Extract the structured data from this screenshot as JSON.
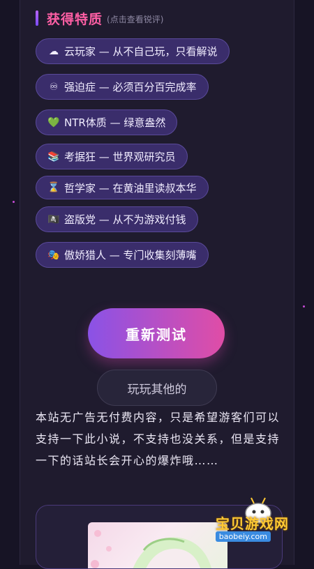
{
  "section": {
    "title": "获得特质",
    "hint": "(点击查看锐评)"
  },
  "traits": [
    {
      "icon": "cloud-icon",
      "glyph": "☁",
      "label": "云玩家 — 从不自己玩，只看解说"
    },
    {
      "icon": "infinity-icon",
      "glyph": "♾",
      "label": "强迫症 — 必须百分百完成率"
    },
    {
      "icon": "green-heart-icon",
      "glyph": "💚",
      "label": "NTR体质 — 绿意盎然"
    },
    {
      "icon": "books-icon",
      "glyph": "📚",
      "label": "考据狂 — 世界观研究员"
    },
    {
      "icon": "hourglass-icon",
      "glyph": "⌛",
      "label": "哲学家 — 在黄油里读叔本华"
    },
    {
      "icon": "pirate-flag-icon",
      "glyph": "🏴‍☠️",
      "label": "盗版党 — 从不为游戏付钱"
    },
    {
      "icon": "theater-masks-icon",
      "glyph": "🎭",
      "label": "傲娇猎人 — 专门收集刻薄嘴"
    }
  ],
  "buttons": {
    "retry": "重新测试",
    "other": "玩玩其他的"
  },
  "notice": "本站无广告无付费内容，只是希望游客们可以支持一下此小说，不支持也没关系，但是支持一下的话站长会开心的爆炸哦……",
  "watermark": {
    "title": "宝贝游戏网",
    "url": "baobeiy.com"
  }
}
